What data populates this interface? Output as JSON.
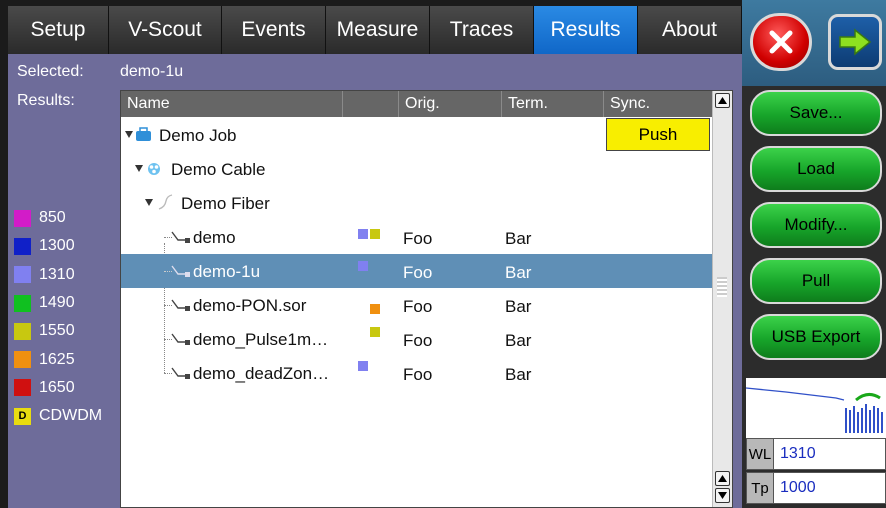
{
  "tabs": [
    {
      "label": "Setup"
    },
    {
      "label": "V-Scout"
    },
    {
      "label": "Events"
    },
    {
      "label": "Measure"
    },
    {
      "label": "Traces"
    },
    {
      "label": "Results",
      "active": true
    },
    {
      "label": "About"
    }
  ],
  "selected": {
    "label": "Selected:",
    "value": "demo-1u"
  },
  "results_label": "Results:",
  "legend": [
    {
      "label": "850",
      "color": "#d21cc8"
    },
    {
      "label": "1300",
      "color": "#1020c8"
    },
    {
      "label": "1310",
      "color": "#8080f0"
    },
    {
      "label": "1490",
      "color": "#10c020"
    },
    {
      "label": "1550",
      "color": "#c8c810"
    },
    {
      "label": "1625",
      "color": "#f09010"
    },
    {
      "label": "1650",
      "color": "#d01010"
    },
    {
      "label": "CDWDM",
      "badge": "D",
      "color": "#e8dc10"
    }
  ],
  "table": {
    "columns": [
      "Name",
      "",
      "Orig.",
      "Term.",
      "Sync."
    ],
    "push_label": "Push",
    "rows": [
      {
        "name": "Demo Job",
        "icon": "briefcase-icon",
        "orig": "",
        "term": ""
      },
      {
        "name": "Demo Cable",
        "icon": "cable-icon",
        "orig": "",
        "term": ""
      },
      {
        "name": "Demo Fiber",
        "icon": "fiber-icon",
        "orig": "",
        "term": ""
      },
      {
        "name": "demo",
        "icon": "trace-icon",
        "orig": "Foo",
        "term": "Bar",
        "swatches": [
          "#8080f0",
          "#c8c810"
        ]
      },
      {
        "name": "demo-1u",
        "icon": "trace-icon",
        "orig": "Foo",
        "term": "Bar",
        "swatches": [
          "#8080f0"
        ],
        "selected": true
      },
      {
        "name": "demo-PON.sor",
        "icon": "trace-icon",
        "orig": "Foo",
        "term": "Bar",
        "swatches": [
          "#f09010"
        ]
      },
      {
        "name": "demo_Pulse1m…",
        "icon": "trace-icon",
        "orig": "Foo",
        "term": "Bar",
        "swatches": [
          "#c8c810"
        ]
      },
      {
        "name": "demo_deadZon…",
        "icon": "trace-icon",
        "orig": "Foo",
        "term": "Bar",
        "swatches": [
          "#8080f0"
        ]
      }
    ]
  },
  "actions": {
    "save": "Save...",
    "load": "Load",
    "modify": "Modify...",
    "pull": "Pull",
    "usb_export": "USB Export"
  },
  "fields": {
    "wl_label": "WL",
    "wl_value": "1310",
    "tp_label": "Tp",
    "tp_value": "1000"
  }
}
